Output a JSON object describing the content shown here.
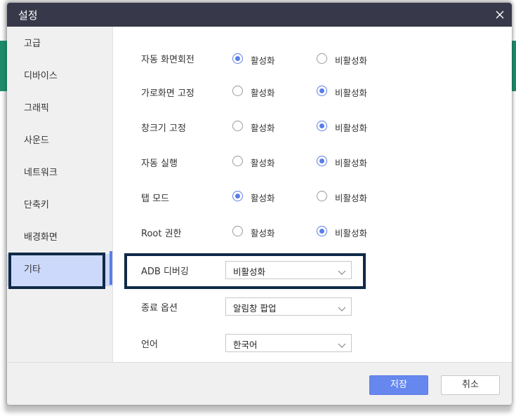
{
  "window": {
    "title": "설정"
  },
  "sidebar": {
    "items": [
      {
        "label": "고급",
        "active": false
      },
      {
        "label": "디바이스",
        "active": false
      },
      {
        "label": "그래픽",
        "active": false
      },
      {
        "label": "사운드",
        "active": false
      },
      {
        "label": "네트워크",
        "active": false
      },
      {
        "label": "단축키",
        "active": false
      },
      {
        "label": "배경화면",
        "active": false
      },
      {
        "label": "기타",
        "active": true
      }
    ]
  },
  "settings": {
    "radio_rows": [
      {
        "label": "자동 화면회전",
        "option_on": "활성화",
        "option_off": "비활성화",
        "selected": "활성화"
      },
      {
        "label": "가로화면 고정",
        "option_on": "활성화",
        "option_off": "비활성화",
        "selected": "비활성화"
      },
      {
        "label": "창크기 고정",
        "option_on": "활성화",
        "option_off": "비활성화",
        "selected": "비활성화"
      },
      {
        "label": "자동 실행",
        "option_on": "활성화",
        "option_off": "비활성화",
        "selected": "비활성화"
      },
      {
        "label": "탭 모드",
        "option_on": "활성화",
        "option_off": "비활성화",
        "selected": "활성화"
      },
      {
        "label": "Root 권한",
        "option_on": "활성화",
        "option_off": "비활성화",
        "selected": "비활성화"
      }
    ],
    "dropdowns": [
      {
        "label": "ADB 디버깅",
        "value": "비활성화"
      },
      {
        "label": "종료 옵션",
        "value": "알림창 팝업"
      },
      {
        "label": "언어",
        "value": "한국어"
      }
    ]
  },
  "footer": {
    "save_label": "저장",
    "cancel_label": "취소"
  },
  "colors": {
    "accent": "#6687ee",
    "titlebar": "#37394a",
    "highlight_outline": "#0f2a47",
    "active_item": "#ccd9fb"
  },
  "icons": {
    "close": "close-icon",
    "dropdown": "chevron-down-icon"
  }
}
